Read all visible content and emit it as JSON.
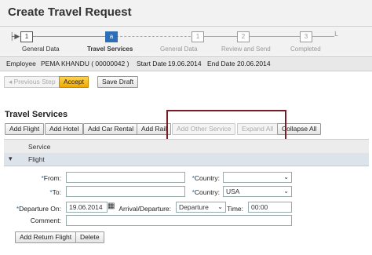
{
  "title": "Create Travel Request",
  "steps": [
    {
      "num": "1",
      "label": "General Data",
      "state": "done"
    },
    {
      "num": "a",
      "label": "Travel Services",
      "state": "current"
    },
    {
      "num": "1",
      "label": "General Data",
      "state": "future"
    },
    {
      "num": "2",
      "label": "Review and Send",
      "state": "future"
    },
    {
      "num": "3",
      "label": "Completed",
      "state": "future"
    }
  ],
  "employee": {
    "label": "Employee",
    "value": "PEMA KHANDU ( 00000042 )",
    "start_label": "Start Date",
    "start": "19.06.2014",
    "end_label": "End Date",
    "end": "20.06.2014"
  },
  "toolbar": {
    "previous": "Previous Step",
    "accept": "Accept",
    "save_draft": "Save Draft"
  },
  "section_title": "Travel Services",
  "service_buttons": {
    "add_flight": "Add Flight",
    "add_hotel": "Add Hotel",
    "add_car": "Add Car Rental",
    "add_rail": "Add Rail",
    "add_other": "Add Other Service",
    "expand_all": "Expand All",
    "collapse_all": "Collapse All"
  },
  "table": {
    "header": "Service",
    "row": "Flight"
  },
  "form": {
    "from_label": "From:",
    "from_value": "",
    "to_label": "To:",
    "to_value": "",
    "country1_label": "Country:",
    "country1_value": "",
    "country2_label": "Country:",
    "country2_value": "USA",
    "departure_label": "Departure On:",
    "departure_value": "19.06.2014",
    "arr_dep_label": "Arrival/Departure:",
    "arr_dep_value": "Departure",
    "time_label": "Time:",
    "time_value": "00:00",
    "comment_label": "Comment:",
    "comment_value": ""
  },
  "bottom_buttons": {
    "add_return": "Add Return Flight",
    "delete": "Delete"
  },
  "colors": {
    "accent": "#2c6fb7",
    "accept": "#f0a800",
    "highlight_box": "#7a1c24"
  }
}
